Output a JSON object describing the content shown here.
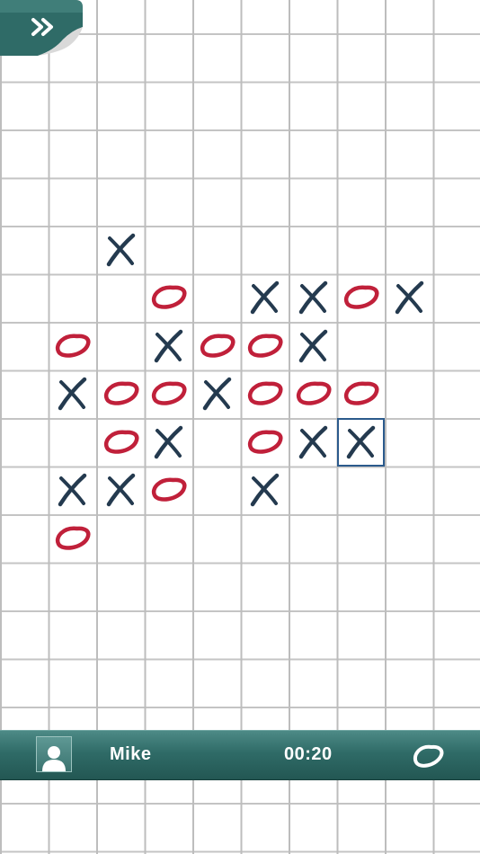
{
  "menu": {
    "icon": "double-chevron-right-icon"
  },
  "status_bar": {
    "avatar_icon": "user-silhouette-icon",
    "player_name": "Mike",
    "timer": "00:20",
    "turn_symbol": "O"
  },
  "colors": {
    "x_mark": "#243a4f",
    "o_mark": "#c0203a",
    "bar": "#2f6b67",
    "selection": "#2b5a8c"
  },
  "board": {
    "columns": 10,
    "rows": 17,
    "selected": {
      "col": 7,
      "row": 8
    },
    "marks": [
      {
        "col": 2,
        "row": 4,
        "symbol": "X"
      },
      {
        "col": 3,
        "row": 5,
        "symbol": "O"
      },
      {
        "col": 5,
        "row": 5,
        "symbol": "X"
      },
      {
        "col": 6,
        "row": 5,
        "symbol": "X"
      },
      {
        "col": 7,
        "row": 5,
        "symbol": "O"
      },
      {
        "col": 8,
        "row": 5,
        "symbol": "X"
      },
      {
        "col": 1,
        "row": 6,
        "symbol": "O"
      },
      {
        "col": 3,
        "row": 6,
        "symbol": "X"
      },
      {
        "col": 4,
        "row": 6,
        "symbol": "O"
      },
      {
        "col": 5,
        "row": 6,
        "symbol": "O"
      },
      {
        "col": 6,
        "row": 6,
        "symbol": "X"
      },
      {
        "col": 1,
        "row": 7,
        "symbol": "X"
      },
      {
        "col": 2,
        "row": 7,
        "symbol": "O"
      },
      {
        "col": 3,
        "row": 7,
        "symbol": "O"
      },
      {
        "col": 4,
        "row": 7,
        "symbol": "X"
      },
      {
        "col": 5,
        "row": 7,
        "symbol": "O"
      },
      {
        "col": 6,
        "row": 7,
        "symbol": "O"
      },
      {
        "col": 7,
        "row": 7,
        "symbol": "O"
      },
      {
        "col": 2,
        "row": 8,
        "symbol": "O"
      },
      {
        "col": 3,
        "row": 8,
        "symbol": "X"
      },
      {
        "col": 5,
        "row": 8,
        "symbol": "O"
      },
      {
        "col": 6,
        "row": 8,
        "symbol": "X"
      },
      {
        "col": 7,
        "row": 8,
        "symbol": "X"
      },
      {
        "col": 1,
        "row": 9,
        "symbol": "X"
      },
      {
        "col": 2,
        "row": 9,
        "symbol": "X"
      },
      {
        "col": 3,
        "row": 9,
        "symbol": "O"
      },
      {
        "col": 5,
        "row": 9,
        "symbol": "X"
      },
      {
        "col": 1,
        "row": 10,
        "symbol": "O"
      }
    ]
  }
}
